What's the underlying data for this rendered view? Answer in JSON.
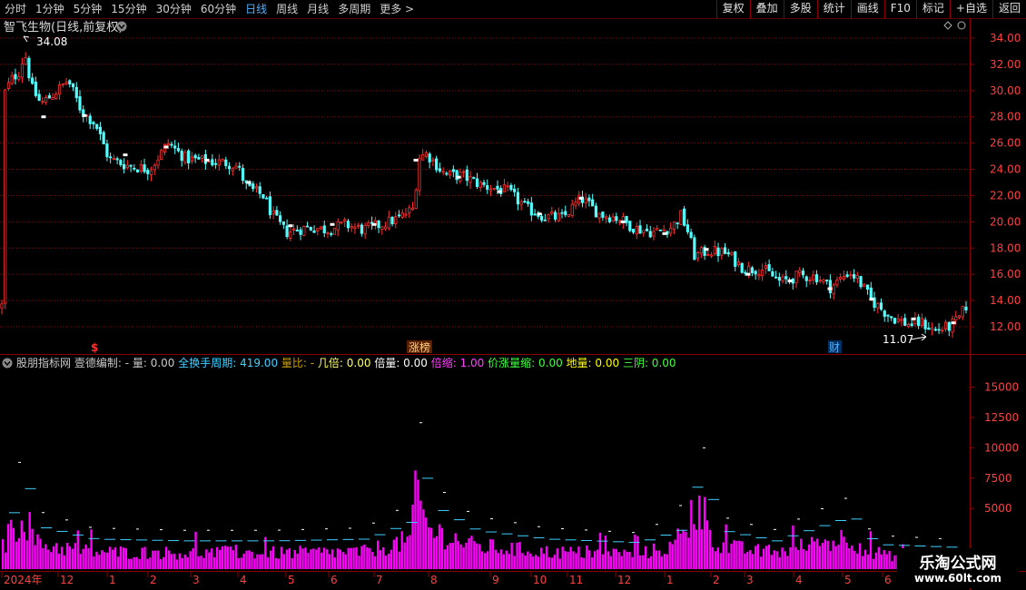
{
  "toolbar": {
    "periods": [
      "分时",
      "1分钟",
      "5分钟",
      "15分钟",
      "30分钟",
      "60分钟",
      "日线",
      "周线",
      "月线",
      "多周期",
      "更多 >"
    ],
    "active_period": "日线",
    "actions": [
      "复权",
      "叠加",
      "多股",
      "统计",
      "画线",
      "F10",
      "标记",
      "+自选",
      "返回"
    ]
  },
  "price_panel": {
    "title": "智飞生物(日线,前复权)",
    "high_label": "34.08",
    "low_label": "11.07",
    "y_ticks": [
      "34.00",
      "32.00",
      "30.00",
      "28.00",
      "26.00",
      "24.00",
      "22.00",
      "20.00",
      "18.00",
      "16.00",
      "14.00",
      "12.00"
    ],
    "markers": [
      {
        "text": "$",
        "color": "#ff3030"
      },
      {
        "text": "涨榜",
        "color": "#ffd080"
      },
      {
        "text": "财",
        "color": "#4fb0ff"
      }
    ]
  },
  "indicator_panel": {
    "legend": [
      {
        "text": "股朋指标网 壹德编制: ",
        "color": "#c8c8c8"
      },
      {
        "text": "- 量: 0.00",
        "color": "#c8c8c8"
      },
      {
        "text": "全换手周期: 419.00",
        "color": "#40d0ff"
      },
      {
        "text": "量比: -",
        "color": "#c8a000"
      },
      {
        "text": "几倍: 0.00",
        "color": "#ffff60"
      },
      {
        "text": "倍量: 0.00",
        "color": "#ffffff"
      },
      {
        "text": "倍缩: 1.00",
        "color": "#ff40ff"
      },
      {
        "text": "价涨量缩: 0.00",
        "color": "#40ff40"
      },
      {
        "text": "地量: 0.00",
        "color": "#ffff00"
      },
      {
        "text": "三阴: 0.00",
        "color": "#40ff40"
      }
    ],
    "y_ticks": [
      "15000",
      "12500",
      "10000",
      "7500",
      "5000"
    ]
  },
  "x_axis": {
    "labels": [
      "2024年",
      "12",
      "1",
      "2",
      "3",
      "4",
      "5",
      "6",
      "7",
      "8",
      "9",
      "10",
      "11",
      "12",
      "1",
      "2",
      "3",
      "4",
      "5",
      "6"
    ]
  },
  "watermark": {
    "title": "乐淘公式网",
    "url": "www.60lt.com"
  },
  "colors": {
    "up": "#ff3030",
    "down": "#54ffff",
    "volume": "#ff00ff",
    "grid": "#8a0000"
  }
}
